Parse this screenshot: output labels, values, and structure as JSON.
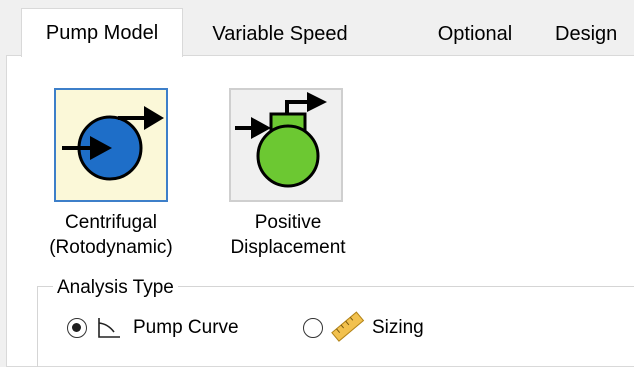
{
  "tabs": [
    {
      "label": "Pump Model",
      "active": true
    },
    {
      "label": "Variable Speed",
      "active": false
    },
    {
      "label": "Optional",
      "active": false
    },
    {
      "label": "Design",
      "active": false
    }
  ],
  "pump_types": [
    {
      "line1": "Centrifugal",
      "line2": "(Rotodynamic)",
      "selected": true,
      "icon": "centrifugal-pump-icon",
      "color": "#1e6ec8"
    },
    {
      "line1": "Positive",
      "line2": "Displacement",
      "selected": false,
      "icon": "positive-displacement-pump-icon",
      "color": "#6cc832"
    }
  ],
  "analysis_type": {
    "title": "Analysis Type",
    "options": [
      {
        "label": "Pump Curve",
        "selected": true,
        "icon": "pump-curve-icon"
      },
      {
        "label": "Sizing",
        "selected": false,
        "icon": "ruler-icon"
      }
    ]
  }
}
